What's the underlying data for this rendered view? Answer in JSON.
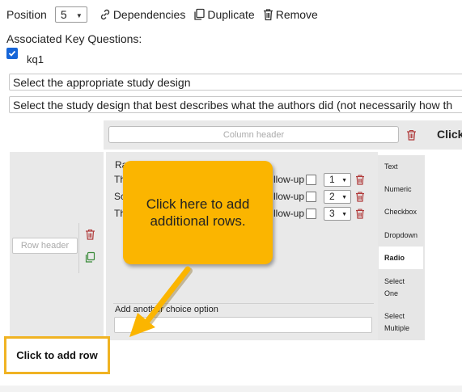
{
  "toolbar": {
    "position_label": "Position",
    "position_value": "5",
    "dependencies_label": "Dependencies",
    "duplicate_label": "Duplicate",
    "remove_label": "Remove"
  },
  "key_questions": {
    "heading": "Associated Key Questions:",
    "items": [
      {
        "label": "kq1",
        "checked": true
      }
    ]
  },
  "question": {
    "title": "Select the appropriate study design",
    "description": "Select the study design that best describes what the authors did (not necessarily how th"
  },
  "matrix": {
    "column_header_placeholder": "Column header",
    "row_header_placeholder": "Row header",
    "right_truncated_label": "Click",
    "cell_title_fragment": "Ra",
    "choices": [
      {
        "prefix": "Th",
        "followup_text": "llow-up",
        "number": "1"
      },
      {
        "prefix": "Sc",
        "followup_text": "llow-up",
        "number": "2"
      },
      {
        "prefix": "Th",
        "followup_text": "llow-up",
        "number": "3"
      }
    ],
    "add_choice_label": "Add another choice option",
    "add_row_label": "Click to add row",
    "field_types": [
      {
        "label": "Text",
        "active": false
      },
      {
        "label": "Numeric",
        "active": false
      },
      {
        "label": "Checkbox",
        "active": false
      },
      {
        "label": "Dropdown",
        "active": false
      },
      {
        "label": "Radio",
        "active": true
      },
      {
        "label": "Select One",
        "active": false
      },
      {
        "label": "Select Multiple",
        "active": false
      }
    ]
  },
  "callout": {
    "text": "Click here to add additional rows."
  },
  "colors": {
    "accent_blue": "#1565d8",
    "callout_yellow": "#fbb500",
    "highlight_border": "#f0b323",
    "trash_red": "#b03a3a",
    "copy_green": "#3a8a3a"
  }
}
